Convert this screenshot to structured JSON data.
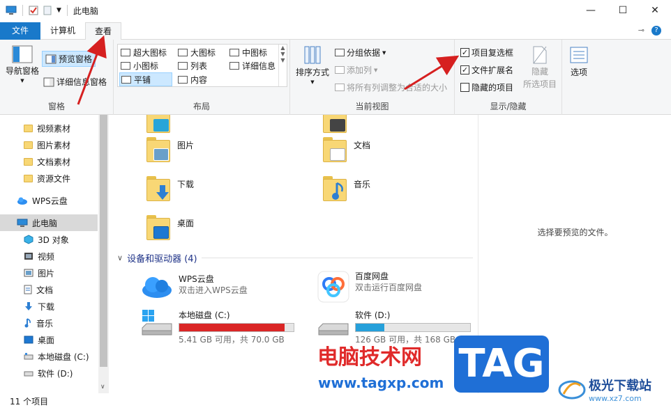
{
  "window": {
    "title": "此电脑",
    "minimize": "—",
    "maximize": "☐",
    "close": "✕"
  },
  "tabs": [
    {
      "label": "文件"
    },
    {
      "label": "计算机"
    },
    {
      "label": "查看"
    }
  ],
  "ribbon": {
    "pane_group": {
      "label": "窗格",
      "nav_pane": "导航窗格",
      "preview_pane": "预览窗格",
      "details_pane": "详细信息窗格"
    },
    "layout_group": {
      "label": "布局",
      "items": [
        "超大图标",
        "大图标",
        "中图标",
        "小图标",
        "列表",
        "详细信息",
        "平铺",
        "内容"
      ]
    },
    "view_group": {
      "label": "当前视图",
      "sort": "排序方式",
      "group_by": "分组依据",
      "add_column": "添加列",
      "fit_columns": "将所有列调整为合适的大小"
    },
    "show_hide_group": {
      "label": "显示/隐藏",
      "item_checkboxes": "项目复选框",
      "item_checkboxes_checked": true,
      "file_extensions": "文件扩展名",
      "file_extensions_checked": true,
      "hidden_items": "隐藏的项目",
      "hidden_items_checked": false,
      "hide_selected_1": "隐藏",
      "hide_selected_2": "所选项目"
    },
    "options": "选项"
  },
  "nav": {
    "items": [
      {
        "label": "视频素材",
        "icon": "folder-icon"
      },
      {
        "label": "图片素材",
        "icon": "folder-icon"
      },
      {
        "label": "文档素材",
        "icon": "folder-icon"
      },
      {
        "label": "资源文件",
        "icon": "folder-icon"
      },
      {
        "label": "WPS云盘",
        "icon": "cloud-icon"
      },
      {
        "label": "此电脑",
        "icon": "computer-icon"
      },
      {
        "label": "3D 对象",
        "icon": "cube-icon"
      },
      {
        "label": "视频",
        "icon": "video-icon"
      },
      {
        "label": "图片",
        "icon": "picture-icon"
      },
      {
        "label": "文档",
        "icon": "document-icon"
      },
      {
        "label": "下载",
        "icon": "download-icon"
      },
      {
        "label": "音乐",
        "icon": "music-icon"
      },
      {
        "label": "桌面",
        "icon": "desktop-icon"
      },
      {
        "label": "本地磁盘 (C:)",
        "icon": "drive-icon"
      },
      {
        "label": "软件 (D:)",
        "icon": "drive-icon"
      }
    ]
  },
  "content": {
    "folders": [
      {
        "label": "图片"
      },
      {
        "label": "文档"
      },
      {
        "label": "下载"
      },
      {
        "label": "音乐"
      },
      {
        "label": "桌面"
      }
    ],
    "devices_header": "设备和驱动器 (4)",
    "wps": {
      "name": "WPS云盘",
      "sub": "双击进入WPS云盘"
    },
    "baidu": {
      "name": "百度网盘",
      "sub": "双击运行百度网盘"
    },
    "drive_c": {
      "name": "本地磁盘 (C:)",
      "sub": "5.41 GB 可用，共 70.0 GB",
      "used_fraction": 0.923,
      "bar_color": "#da2626"
    },
    "drive_d": {
      "name": "软件 (D:)",
      "sub": "126 GB 可用，共 168 GB",
      "used_fraction": 0.25,
      "bar_color": "#26a0da"
    }
  },
  "preview": {
    "empty_text": "选择要预览的文件。"
  },
  "status": {
    "count": "11 个项目"
  },
  "watermark": {
    "site_cn": "电脑技术网",
    "site_url": "www.tagxp.com",
    "tag": "TAG",
    "brand": "极光下载站",
    "brand_url": "www.xz7.com"
  }
}
